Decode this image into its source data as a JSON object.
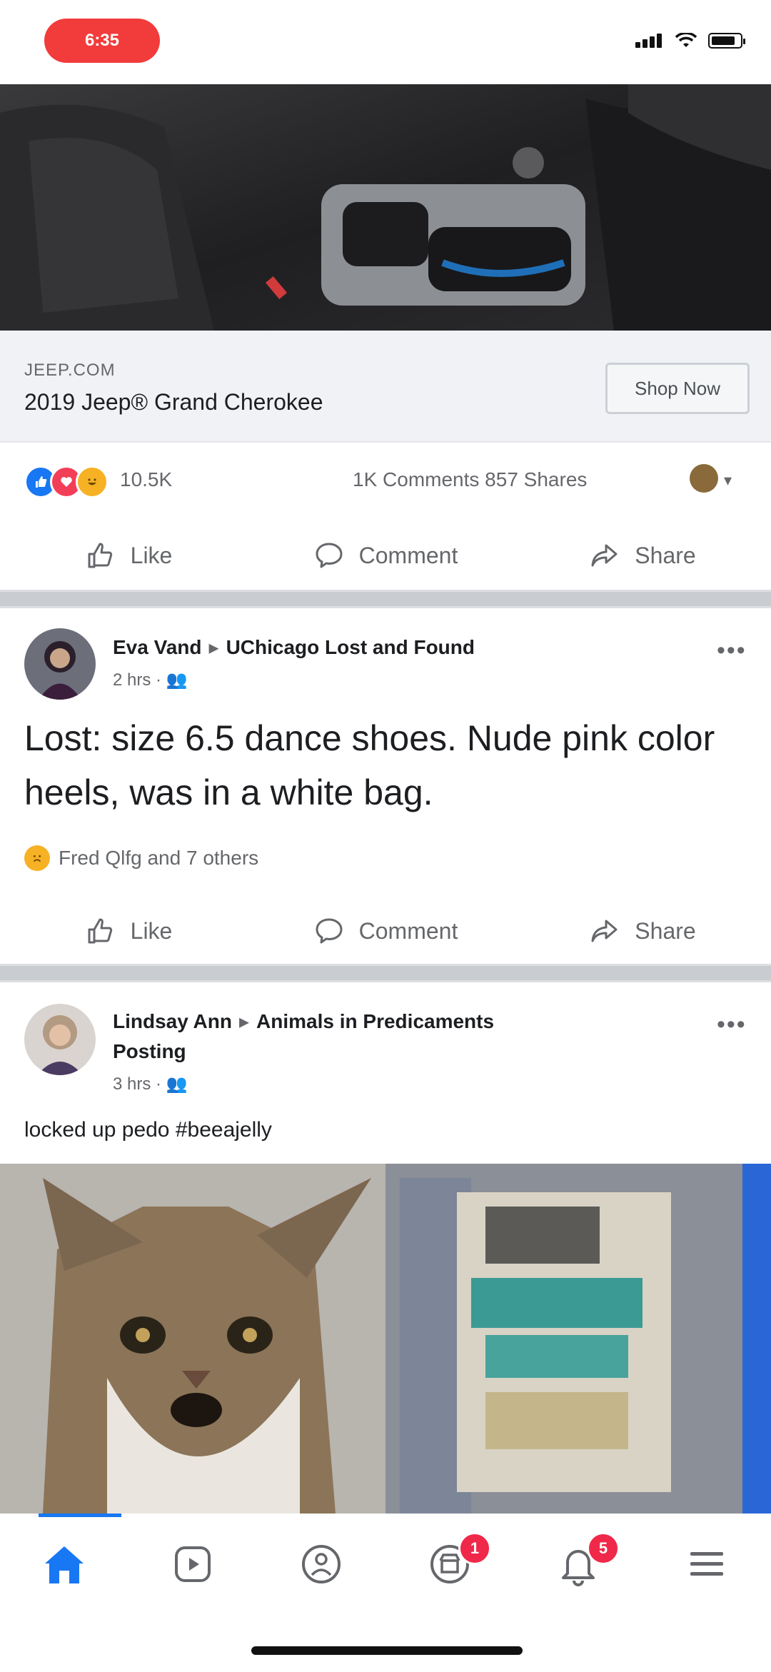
{
  "status_bar": {
    "time": "6:35",
    "icons": [
      "signal-icon",
      "wifi-icon",
      "battery-icon"
    ]
  },
  "ad": {
    "domain": "JEEP.COM",
    "title": "2019 Jeep® Grand Cherokee",
    "cta": "Shop Now",
    "reaction_count": "10.5K",
    "comments_shares": "1K Comments  857 Shares",
    "actions": {
      "like": "Like",
      "comment": "Comment",
      "share": "Share"
    }
  },
  "post1": {
    "author": "Eva Vand",
    "group": "UChicago Lost and Found",
    "time": "2 hrs",
    "text": "Lost: size 6.5 dance shoes. Nude pink color heels, was in a white bag.",
    "reactions_text": "Fred Qlfg and 7 others",
    "actions": {
      "like": "Like",
      "comment": "Comment",
      "share": "Share"
    }
  },
  "post2": {
    "author": "Lindsay Ann",
    "group": "Animals in Predicaments",
    "group_line2": "Posting",
    "time": "3 hrs",
    "text": "locked up pedo #beeajelly"
  },
  "tabbar": {
    "tabs": [
      {
        "name": "home",
        "active": true
      },
      {
        "name": "watch"
      },
      {
        "name": "groups"
      },
      {
        "name": "marketplace",
        "badge": "1"
      },
      {
        "name": "notifications",
        "badge": "5"
      },
      {
        "name": "menu"
      }
    ]
  },
  "colors": {
    "accent": "#1877f2",
    "badge": "#f02849",
    "status_pill": "#f23b3b"
  }
}
